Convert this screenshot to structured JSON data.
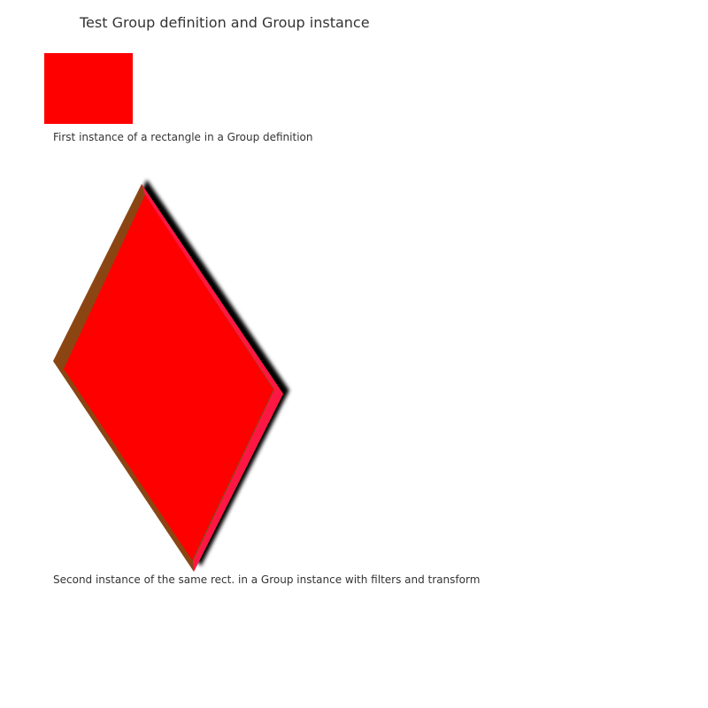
{
  "title": "Test Group definition and Group instance",
  "captions": {
    "first": "First instance of a rectangle in a Group definition",
    "second": "Second instance of the same rect. in a Group instance with filters and transform"
  },
  "colors": {
    "rect_fill": "#ff0000",
    "shadow": "#000000",
    "left_bevel": "#8b4513",
    "right_bevel": "#ff1744"
  }
}
